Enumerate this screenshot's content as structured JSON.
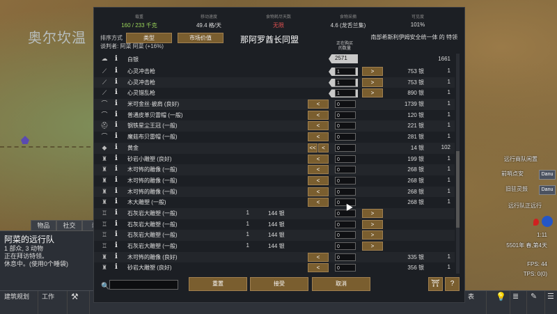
{
  "map": {
    "label_tl": "奥尔坎温",
    "right_labels": [
      "远行商队闲置",
      "前哨点安",
      "Danu",
      "旧驻灵鼓",
      "Danu",
      "远行队正远行"
    ],
    "time": "1:11",
    "date": "5501年 春,第4天",
    "fps": "FPS: 44",
    "tps": "TPS: 0(0)"
  },
  "left_tabs": [
    "物品",
    "社交",
    "装"
  ],
  "caravan": {
    "title": "阿菜的远行队",
    "line1": "1 部众, 3 动物",
    "line2": "正在拜访特领。",
    "line3": "休息中。(使用0个睡袋)"
  },
  "bottom_bar": [
    "建筑规划",
    "工作",
    "",
    "表"
  ],
  "stats": [
    {
      "label": "载重",
      "value": "160 / 233 千克",
      "color": "#9bd65a"
    },
    {
      "label": "移动速度",
      "value": "49.4 格/天",
      "color": "#dddddd"
    },
    {
      "label": "食物耗尽天数",
      "value": "无限",
      "color": "#e05050"
    },
    {
      "label": "食物采摘",
      "value": "4.6 (龙舌兰集)",
      "color": "#dddddd"
    },
    {
      "label": "可见度",
      "value": "101%",
      "color": "#dddddd"
    }
  ],
  "sort": {
    "label": "排序方式",
    "btn1": "类型",
    "btn2": "市场价值"
  },
  "trader": {
    "title": "那阿罗酋长同盟",
    "right": "南部希斯利伊姆安全统一体 的 特领",
    "reason": "谈判者: 阿菜 阿菜 (+16%)"
  },
  "col_head": "正在购买\n的数量",
  "silver": {
    "name": "白银",
    "left_qty": "2571",
    "right_qty": "1661"
  },
  "rows": [
    {
      "icon": "weapon-icon",
      "name": "心灵冲击枪",
      "qleft": "",
      "pleft": "",
      "lbtn": "",
      "qty": "1",
      "arrow": true,
      "rbtn": ">",
      "pright": "753 银",
      "qright": "1"
    },
    {
      "icon": "weapon-icon",
      "name": "心灵冲击枪",
      "qleft": "",
      "pleft": "",
      "lbtn": "",
      "qty": "1",
      "arrow": true,
      "rbtn": ">",
      "pright": "753 银",
      "qright": "1"
    },
    {
      "icon": "weapon-icon",
      "name": "心灵错乱枪",
      "qleft": "",
      "pleft": "",
      "lbtn": "",
      "qty": "1",
      "arrow": true,
      "rbtn": ">",
      "pright": "890 银",
      "qright": "1"
    },
    {
      "icon": "hat-icon",
      "name": "米可金丝·披肩 (良好)",
      "qleft": "",
      "pleft": "",
      "lbtn": "<",
      "qty": "0",
      "arrow": false,
      "rbtn": "",
      "pright": "1739 银",
      "qright": "1"
    },
    {
      "icon": "hat-icon",
      "name": "普通皮革贝雷帽 (一般)",
      "qleft": "",
      "pleft": "",
      "lbtn": "<",
      "qty": "0",
      "arrow": false,
      "rbtn": "",
      "pright": "120 银",
      "qright": "1"
    },
    {
      "icon": "helmet-icon",
      "name": "钢铁星尘王冠 (一般)",
      "qleft": "",
      "pleft": "",
      "lbtn": "<",
      "qty": "0",
      "arrow": false,
      "rbtn": "",
      "pright": "221 银",
      "qright": "1"
    },
    {
      "icon": "hat-icon",
      "name": "魔菇布贝雷帽 (一般)",
      "qleft": "",
      "pleft": "",
      "lbtn": "<",
      "qty": "0",
      "arrow": false,
      "rbtn": "",
      "pright": "281 银",
      "qright": "1"
    },
    {
      "icon": "gold-icon",
      "name": "黄金",
      "qleft": "",
      "pleft": "",
      "lbtn": "<< <",
      "qty": "0",
      "arrow": false,
      "rbtn": "",
      "pright": "14 银",
      "qright": "102"
    },
    {
      "icon": "sculpture-icon",
      "name": "砂岩小雕塑 (良好)",
      "qleft": "",
      "pleft": "",
      "lbtn": "<",
      "qty": "0",
      "arrow": false,
      "rbtn": "",
      "pright": "199 银",
      "qright": "1"
    },
    {
      "icon": "sculpture-icon",
      "name": "木可怖的雕像 (一般)",
      "qleft": "",
      "pleft": "",
      "lbtn": "<",
      "qty": "0",
      "arrow": false,
      "rbtn": "",
      "pright": "268 银",
      "qright": "1"
    },
    {
      "icon": "sculpture-icon",
      "name": "木可怖的雕像 (一般)",
      "qleft": "",
      "pleft": "",
      "lbtn": "<",
      "qty": "0",
      "arrow": false,
      "rbtn": "",
      "pright": "268 银",
      "qright": "1"
    },
    {
      "icon": "sculpture-icon",
      "name": "木可怖的雕像 (一般)",
      "qleft": "",
      "pleft": "",
      "lbtn": "<",
      "qty": "0",
      "arrow": false,
      "rbtn": "",
      "pright": "268 银",
      "qright": "1"
    },
    {
      "icon": "sculpture-icon",
      "name": "木大雕塑 (一般)",
      "qleft": "",
      "pleft": "",
      "lbtn": "<",
      "qty": "0",
      "arrow": false,
      "rbtn": "",
      "pright": "268 银",
      "qright": "1"
    },
    {
      "icon": "stone-sculpture-icon",
      "name": "石灰岩大雕塑 (一般)",
      "qleft": "1",
      "pleft": "144 银",
      "lbtn": "",
      "qty": "0",
      "arrow": false,
      "rbtn": ">",
      "pright": "",
      "qright": ""
    },
    {
      "icon": "stone-sculpture-icon",
      "name": "石灰岩大雕塑 (一般)",
      "qleft": "1",
      "pleft": "144 银",
      "lbtn": "",
      "qty": "0",
      "arrow": false,
      "rbtn": ">",
      "pright": "",
      "qright": ""
    },
    {
      "icon": "stone-sculpture-icon",
      "name": "石灰岩大雕塑 (一般)",
      "qleft": "1",
      "pleft": "144 银",
      "lbtn": "",
      "qty": "0",
      "arrow": false,
      "rbtn": ">",
      "pright": "",
      "qright": ""
    },
    {
      "icon": "stone-sculpture-icon",
      "name": "石灰岩大雕塑 (一般)",
      "qleft": "1",
      "pleft": "144 银",
      "lbtn": "",
      "qty": "0",
      "arrow": false,
      "rbtn": ">",
      "pright": "",
      "qright": ""
    },
    {
      "icon": "sculpture-icon",
      "name": "木可怖的雕像 (良好)",
      "qleft": "",
      "pleft": "",
      "lbtn": "<",
      "qty": "0",
      "arrow": false,
      "rbtn": "",
      "pright": "335 银",
      "qright": "1"
    },
    {
      "icon": "sculpture-icon",
      "name": "砂岩大雕塑 (良好)",
      "qleft": "",
      "pleft": "",
      "lbtn": "<",
      "qty": "0",
      "arrow": false,
      "rbtn": "",
      "pright": "356 银",
      "qright": "1"
    }
  ],
  "buttons": {
    "reset": "重置",
    "accept": "接受",
    "cancel": "取消"
  }
}
